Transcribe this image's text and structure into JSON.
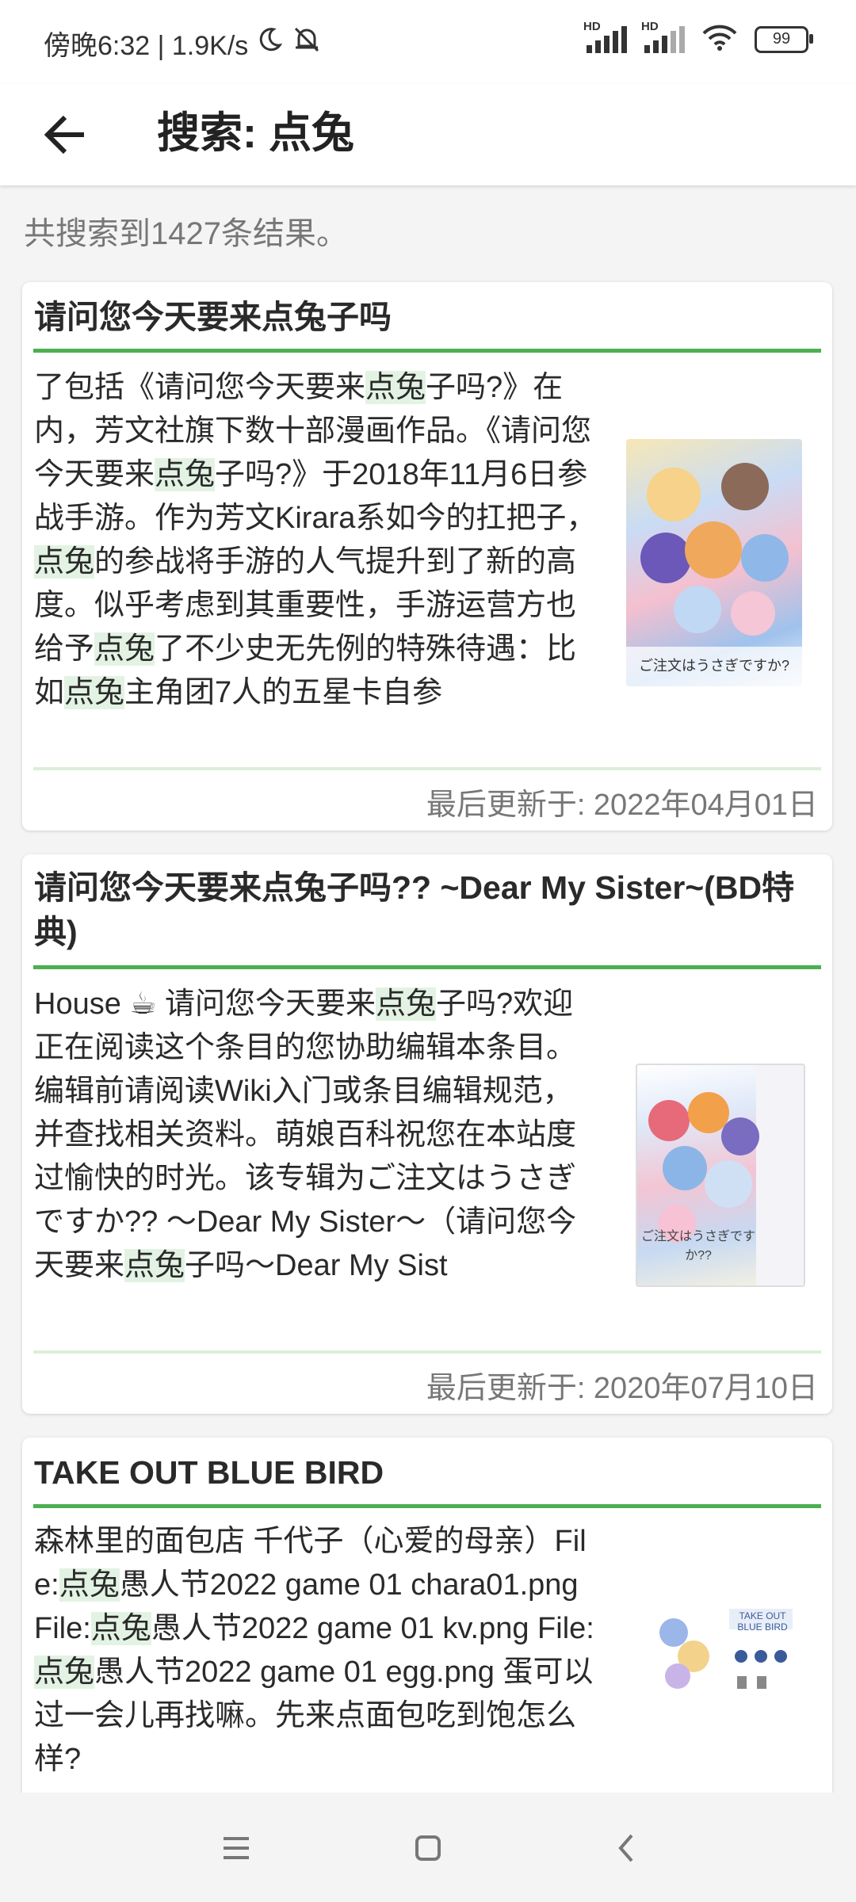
{
  "status_bar": {
    "time_text": "傍晚6:32 | 1.9K/s",
    "network_label_1": "HD",
    "network_label_2": "HD",
    "battery": "99"
  },
  "header": {
    "title": "搜索: 点兔"
  },
  "results": {
    "count_text": "共搜索到1427条结果。",
    "items": [
      {
        "title": "请问您今天要来点兔子吗",
        "snippet": [
          {
            "t": "了包括《请问您今天要来"
          },
          {
            "t": "点兔",
            "hl": true
          },
          {
            "t": "子吗?》在内，芳文社旗下数十部漫画作品。《请问您今天要来"
          },
          {
            "t": "点兔",
            "hl": true
          },
          {
            "t": "子吗?》于2018年11月6日参战手游。作为芳文Kirara系如今的扛把子，"
          },
          {
            "t": "点兔",
            "hl": true
          },
          {
            "t": "的参战将手游的人气提升到了新的高度。似乎考虑到其重要性，手游运营方也给予"
          },
          {
            "t": "点兔",
            "hl": true
          },
          {
            "t": "了不少史无先例的特殊待遇：比如"
          },
          {
            "t": "点兔",
            "hl": true
          },
          {
            "t": "主角团7人的五星卡自参"
          }
        ],
        "thumb_text": "ご注文はうさぎですか?",
        "updated": "最后更新于: 2022年04月01日"
      },
      {
        "title": "请问您今天要来点兔子吗?? ~Dear My Sister~(BD特典)",
        "snippet": [
          {
            "t": "House ☕ 请问您今天要来"
          },
          {
            "t": "点兔",
            "hl": true
          },
          {
            "t": "子吗?欢迎正在阅读这个条目的您协助编辑本条目。编辑前请阅读Wiki入门或条目编辑规范，并查找相关资料。萌娘百科祝您在本站度过愉快的时光。该专辑为ご注文はうさぎですか?? 〜Dear My Sister〜（请问您今天要来"
          },
          {
            "t": "点兔",
            "hl": true
          },
          {
            "t": "子吗〜Dear My Sist"
          }
        ],
        "thumb_text": "ご注文はうさぎですか??",
        "updated": "最后更新于: 2020年07月10日"
      },
      {
        "title": "TAKE OUT BLUE BIRD",
        "snippet": [
          {
            "t": " 森林里的面包店 千代子（心爱的母亲）File:"
          },
          {
            "t": "点兔",
            "hl": true
          },
          {
            "t": "愚人节2022 game 01 chara01.png File:"
          },
          {
            "t": "点兔",
            "hl": true
          },
          {
            "t": "愚人节2022 game 01 kv.png File:"
          },
          {
            "t": "点兔",
            "hl": true
          },
          {
            "t": "愚人节2022 game 01 egg.png 蛋可以过一会儿再找嘛。先来点面包吃到饱怎么样?"
          }
        ],
        "thumb_text": "TAKE OUT BLUE BIRD",
        "updated": ""
      }
    ]
  },
  "colors": {
    "accent": "#4caf50",
    "highlight": "#e3f3e3",
    "text": "#2a2a2a",
    "muted": "#777777"
  },
  "icons": [
    "back-arrow-icon",
    "moon-icon",
    "mute-bell-icon",
    "signal-icon",
    "wifi-icon",
    "battery-icon",
    "menu-icon",
    "home-icon",
    "back-chevron-icon"
  ]
}
